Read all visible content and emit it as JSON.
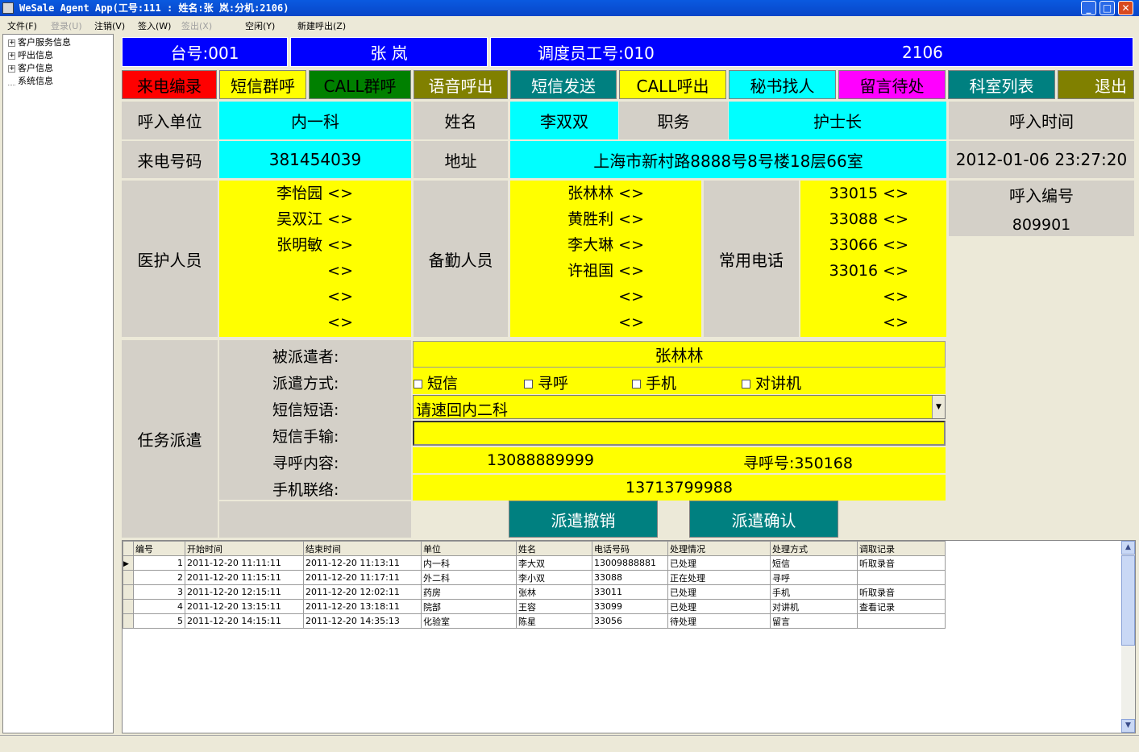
{
  "window": {
    "title": "WeSale Agent App(工号:111 : 姓名:张  岚:分机:2106)"
  },
  "menu": {
    "file": "文件(F)",
    "login": "登录(U)",
    "logout": "注销(V)",
    "checkin": "签入(W)",
    "checkout": "签出(X)",
    "idle": "空闲(Y)",
    "new_call": "新建呼出(Z)"
  },
  "tree": {
    "items": [
      "客户服务信息",
      "呼出信息",
      "客户信息",
      "系统信息"
    ]
  },
  "header": {
    "seat": "台号:001",
    "agent_name": "张  岚",
    "dispatcher": "调度员工号:010",
    "extension": "2106"
  },
  "toolbar": [
    {
      "label": "来电编录",
      "bg": "#ff0000",
      "fg": "#000000"
    },
    {
      "label": "短信群呼",
      "bg": "#ffff00",
      "fg": "#000000"
    },
    {
      "label": "CALL群呼",
      "bg": "#008000",
      "fg": "#000000"
    },
    {
      "label": "语音呼出",
      "bg": "#808000",
      "fg": "#ffffff"
    },
    {
      "label": "短信发送",
      "bg": "#008080",
      "fg": "#ffffff"
    },
    {
      "label": "CALL呼出",
      "bg": "#ffff00",
      "fg": "#000000"
    },
    {
      "label": "秘书找人",
      "bg": "#00ffff",
      "fg": "#000000"
    },
    {
      "label": "留言待处",
      "bg": "#ff00ff",
      "fg": "#000000"
    },
    {
      "label": "科室列表",
      "bg": "#008080",
      "fg": "#ffffff"
    },
    {
      "label": "退出",
      "bg": "#808000",
      "fg": "#ffffff"
    }
  ],
  "caller": {
    "unit_label": "呼入单位",
    "unit": "内一科",
    "name_label": "姓名",
    "name": "李双双",
    "title_label": "职务",
    "title": "护士长",
    "time_label": "呼入时间",
    "time": "2012-01-06 23:27:20",
    "phone_label": "来电号码",
    "phone": "381454039",
    "address_label": "地址",
    "address": "上海市新村路8888号8号楼18层66室",
    "callno_label": "呼入编号",
    "callno": "809901"
  },
  "staff": {
    "medical_label": "医护人员",
    "medical": [
      "李怡园 <>",
      "吴双江 <>",
      "张明敏 <>",
      "<>",
      "<>",
      "<>"
    ],
    "standby_label": "备勤人员",
    "standby": [
      "张林林 <>",
      "黄胜利 <>",
      "李大琳 <>",
      "许祖国 <>",
      "<>",
      "<>"
    ],
    "phones_label": "常用电话",
    "phones": [
      "33015 <>",
      "33088 <>",
      "33066 <>",
      "33016 <>",
      "<>",
      "<>"
    ]
  },
  "dispatch": {
    "section_label": "任务派遣",
    "target_label": "被派遣者:",
    "target": "张林林",
    "method_label": "派遣方式:",
    "methods": [
      "短信",
      "寻呼",
      "手机",
      "对讲机"
    ],
    "sms_template_label": "短信短语:",
    "sms_template": "请速回内二科",
    "sms_input_label": "短信手输:",
    "sms_input": "",
    "pager_label": "寻呼内容:",
    "pager_content": "13088889999",
    "pager_no": "寻呼号:350168",
    "mobile_label": "手机联络:",
    "mobile": "13713799988",
    "cancel_button": "派遣撤销",
    "confirm_button": "派遣确认"
  },
  "grid": {
    "columns": [
      "编号",
      "开始时间",
      "结束时间",
      "单位",
      "姓名",
      "电话号码",
      "处理情况",
      "处理方式",
      "调取记录"
    ],
    "rows": [
      [
        "1",
        "2011-12-20 11:11:11",
        "2011-12-20 11:13:11",
        "内一科",
        "李大双",
        "13009888881",
        "已处理",
        "短信",
        "听取录音"
      ],
      [
        "2",
        "2011-12-20 11:15:11",
        "2011-12-20 11:17:11",
        "外二科",
        "李小双",
        "33088",
        "正在处理",
        "寻呼",
        ""
      ],
      [
        "3",
        "2011-12-20 12:15:11",
        "2011-12-20 12:02:11",
        "药房",
        "张林",
        "33011",
        "已处理",
        "手机",
        "听取录音"
      ],
      [
        "4",
        "2011-12-20 13:15:11",
        "2011-12-20 13:18:11",
        "院部",
        "王容",
        "33099",
        "已处理",
        "对讲机",
        "查看记录"
      ],
      [
        "5",
        "2011-12-20 14:15:11",
        "2011-12-20 14:35:13",
        "化验室",
        "陈星",
        "33056",
        "待处理",
        "留言",
        ""
      ]
    ]
  }
}
